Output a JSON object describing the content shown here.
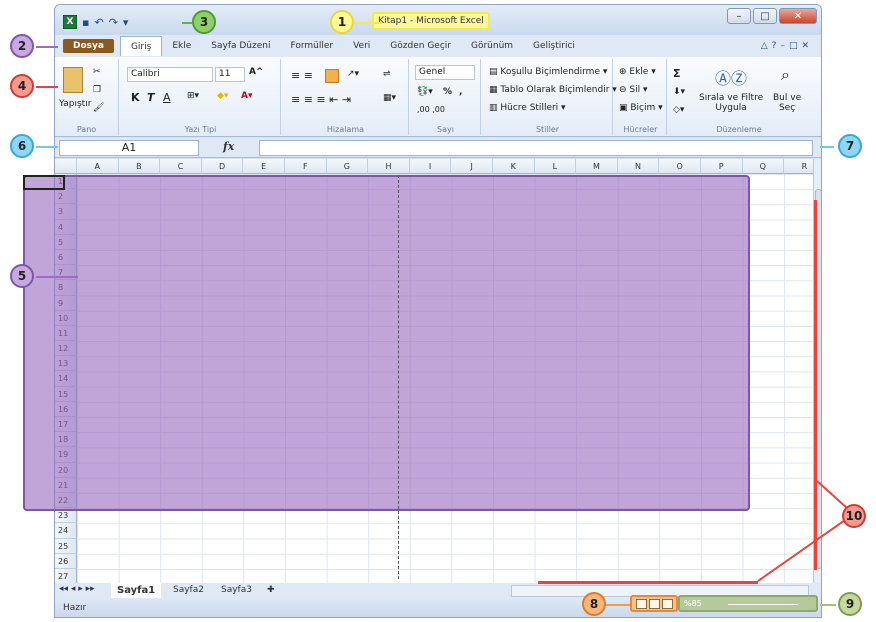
{
  "title": "Kitap1 - Microsoft Excel",
  "callouts": [
    "1",
    "2",
    "3",
    "4",
    "5",
    "6",
    "7",
    "8",
    "9",
    "10"
  ],
  "tabs": {
    "file": "Dosya",
    "home": "Giriş",
    "insert": "Ekle",
    "layout": "Sayfa Düzeni",
    "formulas": "Formüller",
    "data": "Veri",
    "review": "Gözden Geçir",
    "view": "Görünüm",
    "developer": "Geliştirici"
  },
  "ribbon": {
    "clipboard": {
      "label": "Pano",
      "paste": "Yapıştır"
    },
    "font": {
      "label": "Yazı Tipi",
      "name": "Calibri",
      "size": "11",
      "bold": "K",
      "italic": "T",
      "underline": "A"
    },
    "alignment": {
      "label": "Hizalama"
    },
    "number": {
      "label": "Sayı",
      "format": "Genel",
      "percent": "%",
      "comma": ","
    },
    "styles": {
      "label": "Stiller",
      "conditional": "Koşullu Biçimlendirme",
      "table": "Tablo Olarak Biçimlendir",
      "cell": "Hücre Stilleri"
    },
    "cells": {
      "label": "Hücreler",
      "insert": "Ekle",
      "delete": "Sil",
      "format": "Biçim"
    },
    "editing": {
      "label": "Düzenleme",
      "sort1": "Sırala ve Filtre",
      "sort2": "Uygula",
      "find1": "Bul ve",
      "find2": "Seç",
      "sum": "Σ"
    }
  },
  "namebox": "A1",
  "fx": "fx",
  "columns": [
    "A",
    "B",
    "C",
    "D",
    "E",
    "F",
    "G",
    "H",
    "I",
    "J",
    "K",
    "L",
    "M",
    "N",
    "O",
    "P",
    "Q",
    "R"
  ],
  "rows": [
    "1",
    "2",
    "3",
    "4",
    "5",
    "6",
    "7",
    "8",
    "9",
    "10",
    "11",
    "12",
    "13",
    "14",
    "15",
    "16",
    "17",
    "18",
    "19",
    "20",
    "21",
    "22",
    "23",
    "24",
    "25",
    "26",
    "27"
  ],
  "sheets": [
    "Sayfa1",
    "Sayfa2",
    "Sayfa3"
  ],
  "status": "Hazır",
  "zoom": "%85",
  "colors": {
    "callout_yellow": "#fdf79b",
    "callout_purple": "#9b6cc0",
    "callout_green": "#8fbf5a",
    "callout_red": "#e8443a",
    "callout_blue": "#6ec8ee",
    "callout_orange": "#f19a4a",
    "callout_olive": "#a7bf7a"
  }
}
